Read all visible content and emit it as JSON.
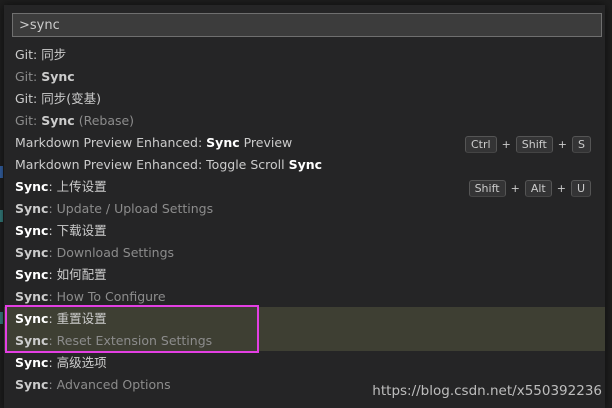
{
  "search": {
    "value": ">sync"
  },
  "items": [
    {
      "type": "double",
      "line1": [
        {
          "t": "Git: 同步",
          "b": false
        }
      ],
      "line2": [
        {
          "t": "Git: ",
          "b": false
        },
        {
          "t": "Sync",
          "b": true
        }
      ],
      "keys": []
    },
    {
      "type": "double",
      "line1": [
        {
          "t": "Git: 同步(变基)",
          "b": false
        }
      ],
      "line2": [
        {
          "t": "Git: ",
          "b": false
        },
        {
          "t": "Sync",
          "b": true
        },
        {
          "t": " (Rebase)",
          "b": false
        }
      ],
      "keys": []
    },
    {
      "type": "single",
      "line1": [
        {
          "t": "Markdown Preview Enhanced: ",
          "b": false
        },
        {
          "t": "Sync",
          "b": true
        },
        {
          "t": " Preview",
          "b": false
        }
      ],
      "keys": [
        "Ctrl",
        "Shift",
        "S"
      ]
    },
    {
      "type": "single",
      "line1": [
        {
          "t": "Markdown Preview Enhanced: Toggle Scroll ",
          "b": false
        },
        {
          "t": "Sync",
          "b": true
        }
      ],
      "keys": []
    },
    {
      "type": "double",
      "line1": [
        {
          "t": "Sync",
          "b": true
        },
        {
          "t": ": 上传设置",
          "b": false
        }
      ],
      "line2": [
        {
          "t": "Sync",
          "b": true
        },
        {
          "t": ": Update / Upload Settings",
          "b": false
        }
      ],
      "keys": [
        "Shift",
        "Alt",
        "U"
      ]
    },
    {
      "type": "double",
      "line1": [
        {
          "t": "Sync",
          "b": true
        },
        {
          "t": ": 下载设置",
          "b": false
        }
      ],
      "line2": [
        {
          "t": "Sync",
          "b": true
        },
        {
          "t": ": Download Settings",
          "b": false
        }
      ],
      "keys": []
    },
    {
      "type": "double",
      "line1": [
        {
          "t": "Sync",
          "b": true
        },
        {
          "t": ": 如何配置",
          "b": false
        }
      ],
      "line2": [
        {
          "t": "Sync",
          "b": true
        },
        {
          "t": ": How To Configure",
          "b": false
        }
      ],
      "keys": []
    },
    {
      "type": "double",
      "selected": true,
      "line1": [
        {
          "t": "Sync",
          "b": true
        },
        {
          "t": ": 重置设置",
          "b": false
        }
      ],
      "line2": [
        {
          "t": "Sync",
          "b": true
        },
        {
          "t": ": Reset Extension Settings",
          "b": false
        }
      ],
      "keys": []
    },
    {
      "type": "double",
      "line1": [
        {
          "t": "Sync",
          "b": true
        },
        {
          "t": ": 高级选项",
          "b": false
        }
      ],
      "line2": [
        {
          "t": "Sync",
          "b": true
        },
        {
          "t": ": Advanced Options",
          "b": false
        }
      ],
      "keys": []
    }
  ],
  "watermark": "https://blog.csdn.net/x550392236",
  "colors": {
    "highlight_border": "#e33fe3",
    "selected_bg": "#3e3f33",
    "palette_bg": "#252526"
  }
}
